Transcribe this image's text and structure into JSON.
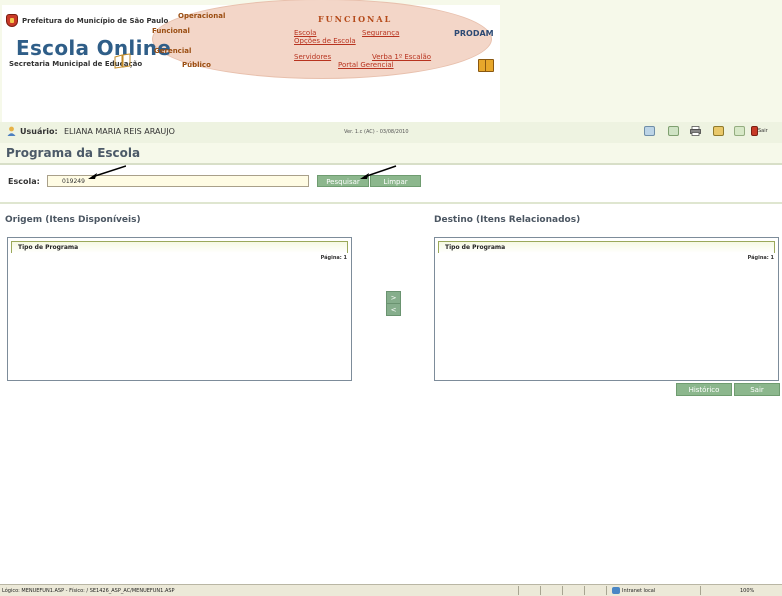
{
  "banner": {
    "prefeitura": "Prefeitura do Município de São Paulo",
    "app_name": "Escola Online",
    "secretaria": "Secretaria Municipal de Educação",
    "menus": {
      "operacional": "Operacional",
      "funcional": "Funcional",
      "gerencial": "Gerencial",
      "publico": "Público"
    },
    "section_title": "FUNCIONAL",
    "links": {
      "escola": "Escola",
      "seguranca": "Segurança",
      "opcoes": "Opções de Escola",
      "servidores": "Servidores",
      "verba": "Verba 1º Escalão",
      "portal": "Portal Gerencial"
    },
    "prodam": "PRODAM"
  },
  "user_bar": {
    "label": "Usuário:",
    "name": "ELIANA MARIA REIS ARAUJO",
    "version": "Ver. 1.c (AC) - 03/08/2010",
    "sair": "Sair"
  },
  "page": {
    "title": "Programa da Escola"
  },
  "search": {
    "escola_label": "Escola:",
    "escola_value": "019249",
    "pesquisar": "Pesquisar",
    "limpar": "Limpar"
  },
  "origem": {
    "title": "Origem (Itens Disponíveis)",
    "column": "Tipo de Programa",
    "pagina": "Página: 1"
  },
  "destino": {
    "title": "Destino (Itens Relacionados)",
    "column": "Tipo de Programa",
    "pagina": "Página: 1"
  },
  "transfer": {
    "right": ">",
    "left": "<"
  },
  "actions": {
    "historico": "Histórico",
    "sair": "Sair"
  },
  "status_bar": {
    "path": "Lógico: MENUEFUN1.ASP - Físico: / SE1426_ASP_AC/MENUEFUN1.ASP",
    "zone": "Intranet local",
    "zoom": "100%"
  },
  "colors": {
    "accent_green": "#8cb78d",
    "header_band": "#eef3e1",
    "link_red": "#b8331f",
    "title_text": "#4c5a68"
  }
}
